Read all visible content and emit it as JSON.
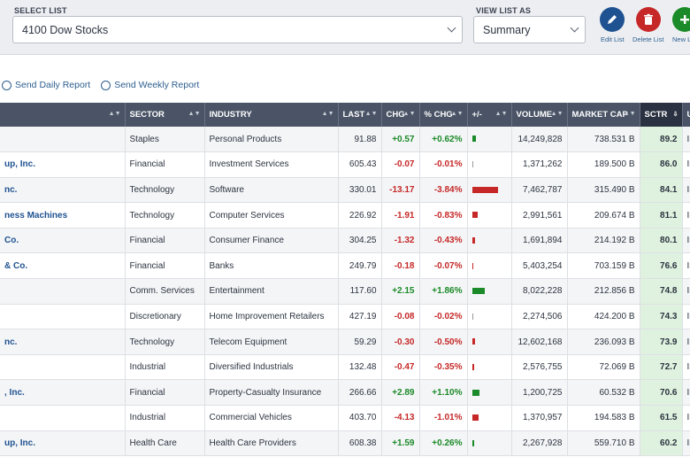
{
  "select_list": {
    "label": "SELECT LIST",
    "value": "4100 Dow Stocks"
  },
  "view_list": {
    "label": "VIEW LIST AS",
    "value": "Summary"
  },
  "actions": {
    "edit": "Edit List",
    "delete": "Delete List",
    "new": "New L"
  },
  "reports": {
    "daily": "Send Daily Report",
    "weekly": "Send Weekly Report"
  },
  "colors": {
    "header_bg": "#4a5466",
    "positive": "#1b8a28",
    "negative": "#c62828",
    "edit_btn": "#1f5290",
    "delete_btn": "#c62828",
    "new_btn": "#1b8a28"
  },
  "table": {
    "columns": [
      "",
      "SECTOR",
      "INDUSTRY",
      "LAST",
      "CHG",
      "% CHG",
      "+/-",
      "VOLUME",
      "MARKET CAP",
      "SCTR",
      "U"
    ],
    "rows": [
      {
        "name": "",
        "sector": "Staples",
        "industry": "Personal Products",
        "last": "91.88",
        "chg": "+0.57",
        "pchg": "+0.62%",
        "pct": 0.62,
        "volume": "14,249,828",
        "mcap": "738.531 B",
        "sctr": "89.2",
        "u": "In"
      },
      {
        "name": "up, Inc.",
        "sector": "Financial",
        "industry": "Investment Services",
        "last": "605.43",
        "chg": "-0.07",
        "pchg": "-0.01%",
        "pct": -0.01,
        "volume": "1,371,262",
        "mcap": "189.500 B",
        "sctr": "86.0",
        "u": "In"
      },
      {
        "name": "nc.",
        "sector": "Technology",
        "industry": "Software",
        "last": "330.01",
        "chg": "-13.17",
        "pchg": "-3.84%",
        "pct": -3.84,
        "volume": "7,462,787",
        "mcap": "315.490 B",
        "sctr": "84.1",
        "u": "In"
      },
      {
        "name": "ness Machines",
        "sector": "Technology",
        "industry": "Computer Services",
        "last": "226.92",
        "chg": "-1.91",
        "pchg": "-0.83%",
        "pct": -0.83,
        "volume": "2,991,561",
        "mcap": "209.674 B",
        "sctr": "81.1",
        "u": "In"
      },
      {
        "name": "Co.",
        "sector": "Financial",
        "industry": "Consumer Finance",
        "last": "304.25",
        "chg": "-1.32",
        "pchg": "-0.43%",
        "pct": -0.43,
        "volume": "1,691,894",
        "mcap": "214.192 B",
        "sctr": "80.1",
        "u": "In"
      },
      {
        "name": "& Co.",
        "sector": "Financial",
        "industry": "Banks",
        "last": "249.79",
        "chg": "-0.18",
        "pchg": "-0.07%",
        "pct": -0.07,
        "volume": "5,403,254",
        "mcap": "703.159 B",
        "sctr": "76.6",
        "u": "In"
      },
      {
        "name": "",
        "sector": "Comm. Services",
        "industry": "Entertainment",
        "last": "117.60",
        "chg": "+2.15",
        "pchg": "+1.86%",
        "pct": 1.86,
        "volume": "8,022,228",
        "mcap": "212.856 B",
        "sctr": "74.8",
        "u": "In"
      },
      {
        "name": "",
        "sector": "Discretionary",
        "industry": "Home Improvement Retailers",
        "last": "427.19",
        "chg": "-0.08",
        "pchg": "-0.02%",
        "pct": -0.02,
        "volume": "2,274,506",
        "mcap": "424.200 B",
        "sctr": "74.3",
        "u": "In"
      },
      {
        "name": "nc.",
        "sector": "Technology",
        "industry": "Telecom Equipment",
        "last": "59.29",
        "chg": "-0.30",
        "pchg": "-0.50%",
        "pct": -0.5,
        "volume": "12,602,168",
        "mcap": "236.093 B",
        "sctr": "73.9",
        "u": "In"
      },
      {
        "name": "",
        "sector": "Industrial",
        "industry": "Diversified Industrials",
        "last": "132.48",
        "chg": "-0.47",
        "pchg": "-0.35%",
        "pct": -0.35,
        "volume": "2,576,755",
        "mcap": "72.069 B",
        "sctr": "72.7",
        "u": "In"
      },
      {
        "name": ", Inc.",
        "sector": "Financial",
        "industry": "Property-Casualty Insurance",
        "last": "266.66",
        "chg": "+2.89",
        "pchg": "+1.10%",
        "pct": 1.1,
        "volume": "1,200,725",
        "mcap": "60.532 B",
        "sctr": "70.6",
        "u": "In"
      },
      {
        "name": "",
        "sector": "Industrial",
        "industry": "Commercial Vehicles",
        "last": "403.70",
        "chg": "-4.13",
        "pchg": "-1.01%",
        "pct": -1.01,
        "volume": "1,370,957",
        "mcap": "194.583 B",
        "sctr": "61.5",
        "u": "In"
      },
      {
        "name": "up, Inc.",
        "sector": "Health Care",
        "industry": "Health Care Providers",
        "last": "608.38",
        "chg": "+1.59",
        "pchg": "+0.26%",
        "pct": 0.26,
        "volume": "2,267,928",
        "mcap": "559.710 B",
        "sctr": "60.2",
        "u": "In"
      }
    ]
  }
}
